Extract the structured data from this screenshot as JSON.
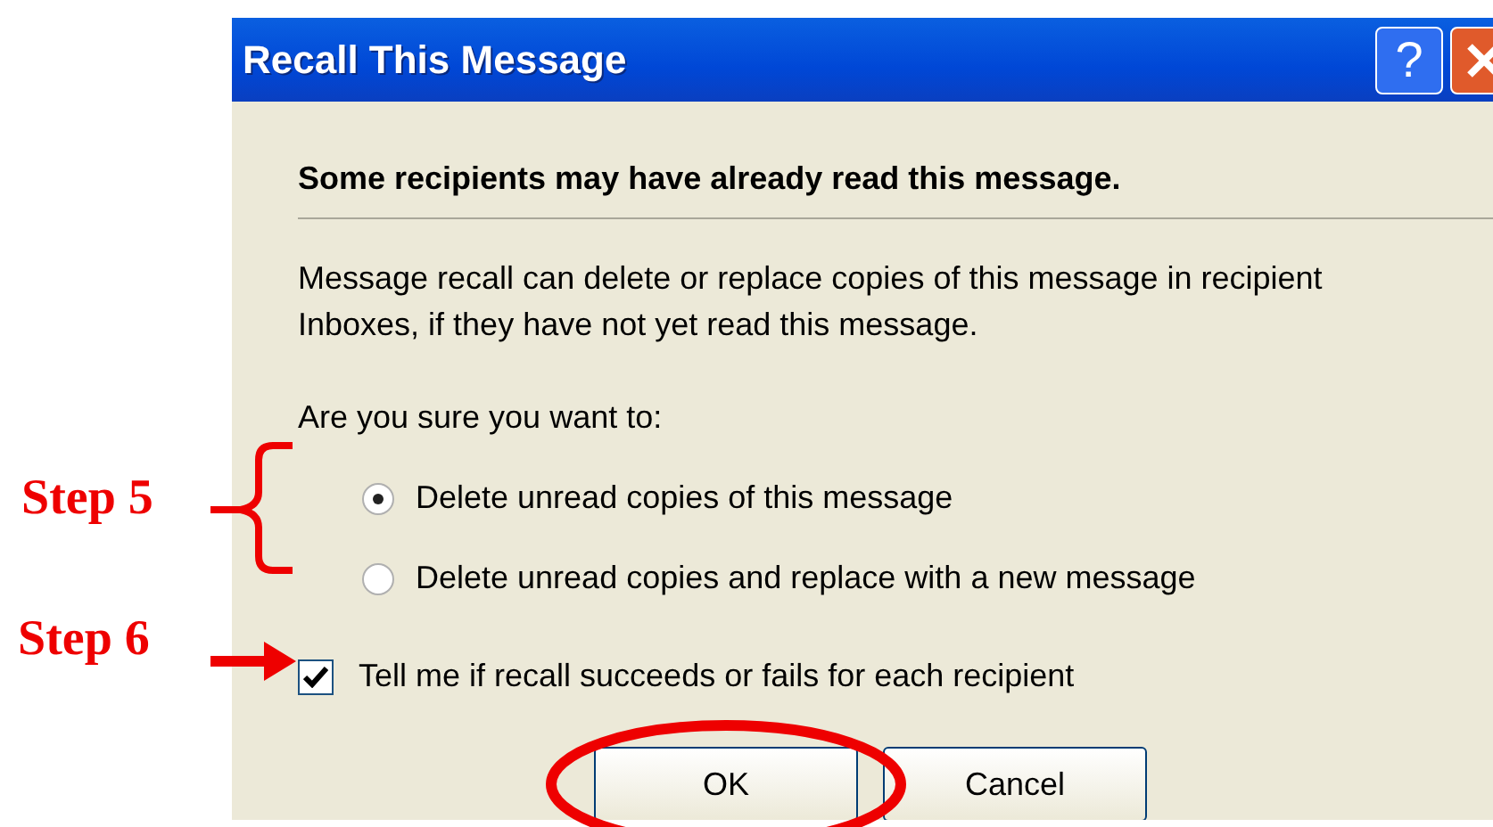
{
  "window": {
    "title": "Recall This Message",
    "help_button": "?"
  },
  "heading": "Some recipients may have already read this message.",
  "message": "Message recall can delete or replace copies of this message in recipient Inboxes, if they have not yet read this message.",
  "prompt": "Are you sure you want to:",
  "options": [
    {
      "label": "Delete unread copies of this message",
      "selected": true
    },
    {
      "label": "Delete unread copies and replace with a new message",
      "selected": false
    }
  ],
  "notify": {
    "label": "Tell me if recall succeeds or fails for each recipient",
    "checked": true
  },
  "buttons": [
    {
      "label": "OK",
      "circled": true
    },
    {
      "label": "Cancel",
      "circled": false
    }
  ],
  "annotations": [
    {
      "kind": "brace",
      "label": "Step 5"
    },
    {
      "kind": "arrow",
      "label": "Step 6"
    }
  ]
}
